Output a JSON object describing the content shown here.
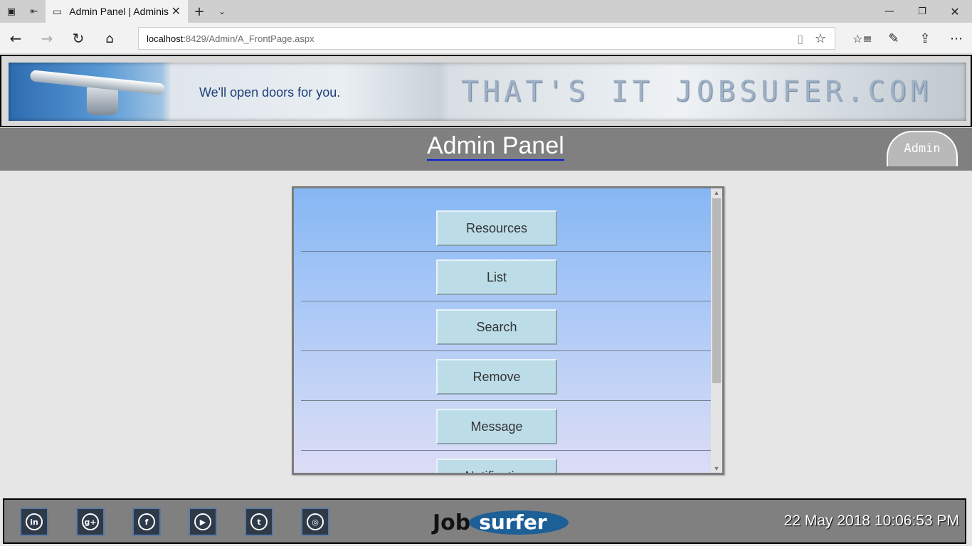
{
  "browser": {
    "tab_title": "Admin Panel | Administ",
    "url_host": "localhost",
    "url_path": ":8429/Admin/A_FrontPage.aspx"
  },
  "banner": {
    "tagline": "We'll open doors for you.",
    "logo_text": "THAT'S IT JOBSUFER.COM"
  },
  "header": {
    "title": "Admin Panel",
    "user_tab": "Admin"
  },
  "menu": {
    "items": [
      {
        "label": "Resources"
      },
      {
        "label": "List"
      },
      {
        "label": "Search"
      },
      {
        "label": "Remove"
      },
      {
        "label": "Message"
      },
      {
        "label": "Notification"
      }
    ]
  },
  "footer": {
    "social": [
      {
        "icon": "linkedin-icon",
        "glyph": "in"
      },
      {
        "icon": "google-plus-icon",
        "glyph": "g+"
      },
      {
        "icon": "facebook-icon",
        "glyph": "f"
      },
      {
        "icon": "youtube-icon",
        "glyph": "▶"
      },
      {
        "icon": "twitter-icon",
        "glyph": "t"
      },
      {
        "icon": "instagram-icon",
        "glyph": "◎"
      }
    ],
    "logo_left": "Job",
    "logo_right": "surfer",
    "datetime": "22 May 2018 10:06:53 PM"
  }
}
